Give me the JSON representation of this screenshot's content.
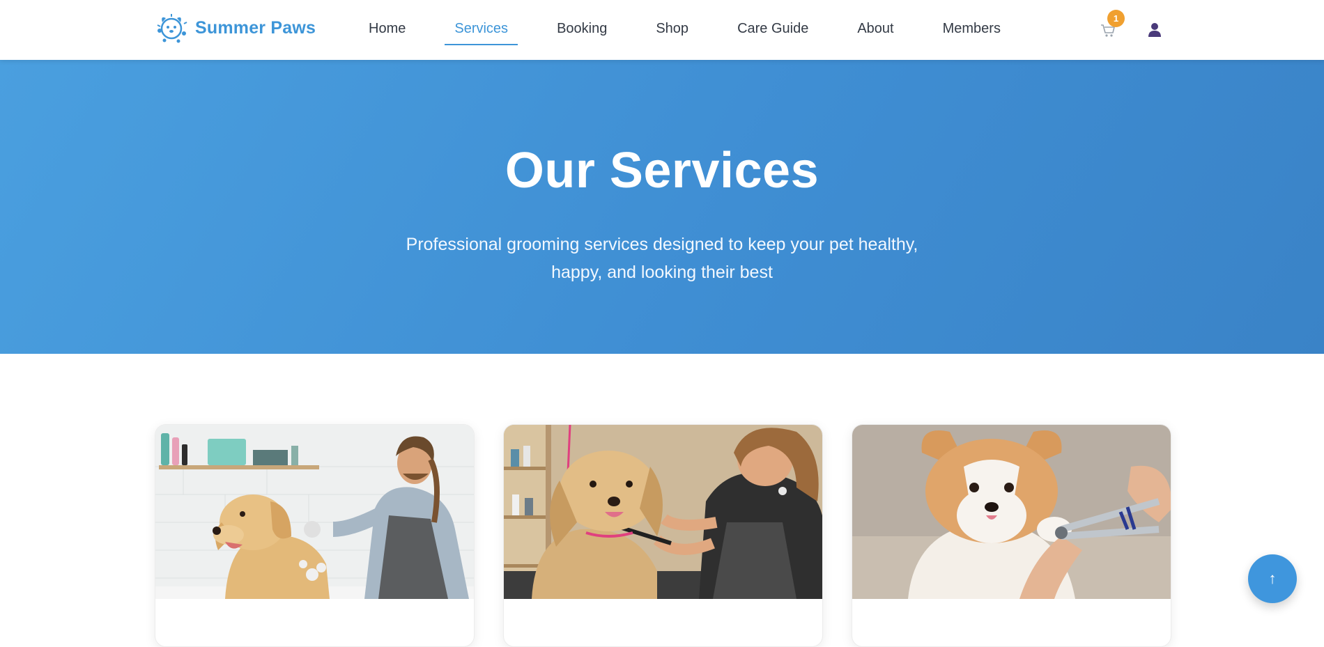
{
  "brand": {
    "name": "Summer Paws",
    "logo_icon": "paw-dog-logo-icon",
    "color": "#3d95d8"
  },
  "nav": {
    "items": [
      {
        "label": "Home",
        "active": false
      },
      {
        "label": "Services",
        "active": true
      },
      {
        "label": "Booking",
        "active": false
      },
      {
        "label": "Shop",
        "active": false
      },
      {
        "label": "Care Guide",
        "active": false
      },
      {
        "label": "About",
        "active": false
      },
      {
        "label": "Members",
        "active": false
      }
    ]
  },
  "cart": {
    "icon": "cart-icon",
    "count": "1",
    "badge_color": "#f0a030"
  },
  "user": {
    "icon": "user-icon",
    "color": "#4a3a7a"
  },
  "hero": {
    "title": "Our Services",
    "subtitle": "Professional grooming services designed to keep your pet healthy, happy, and looking their best",
    "background": "#4297da"
  },
  "cards": [
    {
      "image": "groomer bathing a golden retriever"
    },
    {
      "image": "groomer brushing a fluffy small dog"
    },
    {
      "image": "corgi getting nails trimmed"
    }
  ],
  "scroll_top": {
    "label": "↑",
    "icon": "arrow-up-icon"
  }
}
